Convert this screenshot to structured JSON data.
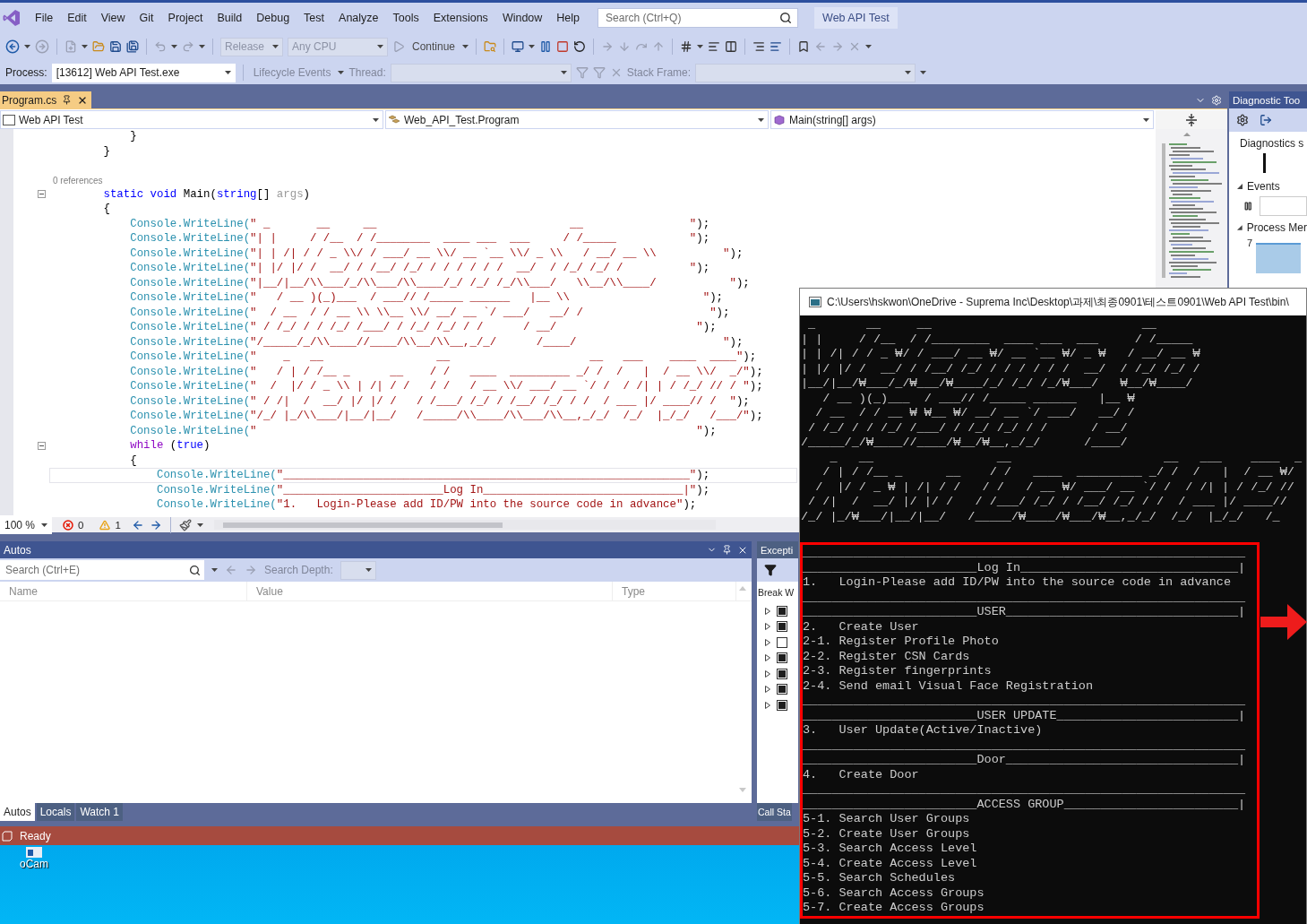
{
  "menu": [
    "File",
    "Edit",
    "View",
    "Git",
    "Project",
    "Build",
    "Debug",
    "Test",
    "Analyze",
    "Tools",
    "Extensions",
    "Window",
    "Help"
  ],
  "search": {
    "placeholder": "Search (Ctrl+Q)"
  },
  "solution_name": "Web API Test",
  "toolbar": {
    "configuration": {
      "value": "Release",
      "disabled": true
    },
    "platform": {
      "value": "Any CPU",
      "disabled": true
    },
    "continue": {
      "label": "Continue"
    }
  },
  "debug_location": {
    "process": {
      "label": "Process:",
      "value": "[13612] Web API Test.exe",
      "disabled": false
    },
    "lifecycle": {
      "label": "Lifecycle Events",
      "disabled": true
    },
    "thread": {
      "label": "Thread:",
      "disabled": true
    },
    "stack_frame": {
      "label": "Stack Frame:",
      "disabled": true
    }
  },
  "document_tabs": [
    {
      "label": "Program.cs",
      "selected": true
    }
  ],
  "navigation": [
    "Web API Test",
    "Web_API_Test.Program",
    "Main(string[] args)"
  ],
  "code_lines": [
    {
      "kind": "code",
      "tokens": [
        {
          "kind": "pl",
          "text": "            }"
        }
      ]
    },
    {
      "kind": "code",
      "tokens": [
        {
          "kind": "pl",
          "text": "        }"
        }
      ]
    },
    {
      "kind": "blank"
    },
    {
      "kind": "lens",
      "text": "0 references"
    },
    {
      "kind": "code",
      "fold": true,
      "tokens": [
        {
          "kind": "kw",
          "text": "        static void"
        },
        {
          "kind": "pl",
          "text": " Main("
        },
        {
          "kind": "kw",
          "text": "string"
        },
        {
          "kind": "pl",
          "text": "[] "
        },
        {
          "kind": "dim",
          "text": "args"
        },
        {
          "kind": "pl",
          "text": ")"
        }
      ]
    },
    {
      "kind": "code",
      "tokens": [
        {
          "kind": "pl",
          "text": "        {"
        }
      ]
    },
    {
      "kind": "code",
      "tokens": [
        {
          "kind": "call",
          "text": "            Console.WriteLine("
        },
        {
          "kind": "str",
          "text": "\" _       __     __                             __                \""
        },
        {
          "kind": "pl",
          "text": ");"
        }
      ]
    },
    {
      "kind": "code",
      "tokens": [
        {
          "kind": "call",
          "text": "            Console.WriteLine("
        },
        {
          "kind": "str",
          "text": "\"| |     / /__  / /________  ____ ___  ___     / /_____           \""
        },
        {
          "kind": "pl",
          "text": ");"
        }
      ]
    },
    {
      "kind": "code",
      "tokens": [
        {
          "kind": "call",
          "text": "            Console.WriteLine("
        },
        {
          "kind": "str",
          "text": "\"| | /| / / _ \\\\/ / ___/ __ \\\\/ __ `__ \\\\/ _ \\\\   / __/ __ \\\\          \""
        },
        {
          "kind": "pl",
          "text": ");"
        }
      ]
    },
    {
      "kind": "code",
      "tokens": [
        {
          "kind": "call",
          "text": "            Console.WriteLine("
        },
        {
          "kind": "str",
          "text": "\"| |/ |/ /  __/ / /__/ /_/ / / / / / /  __/  / /_/ /_/ /          \""
        },
        {
          "kind": "pl",
          "text": ");"
        }
      ]
    },
    {
      "kind": "code",
      "tokens": [
        {
          "kind": "call",
          "text": "            Console.WriteLine("
        },
        {
          "kind": "str",
          "text": "\"|__/|__/\\\\___/_/\\\\___/\\\\____/_/ /_/ /_/\\\\___/   \\\\__/\\\\____/           \""
        },
        {
          "kind": "pl",
          "text": ");"
        }
      ]
    },
    {
      "kind": "code",
      "tokens": [
        {
          "kind": "call",
          "text": "            Console.WriteLine("
        },
        {
          "kind": "str",
          "text": "\"   / __ )(_)___  / ___// /_____ ______   |__ \\\\                    \""
        },
        {
          "kind": "pl",
          "text": ");"
        }
      ]
    },
    {
      "kind": "code",
      "tokens": [
        {
          "kind": "call",
          "text": "            Console.WriteLine("
        },
        {
          "kind": "str",
          "text": "\"  / __  / / __ \\\\ \\\\__ \\\\/ __/ __ `/ ___/   __/ /                   \""
        },
        {
          "kind": "pl",
          "text": ");"
        }
      ]
    },
    {
      "kind": "code",
      "tokens": [
        {
          "kind": "call",
          "text": "            Console.WriteLine("
        },
        {
          "kind": "str",
          "text": "\" / /_/ / / /_/ /___/ / /_/ /_/ / /      / __/                     \""
        },
        {
          "kind": "pl",
          "text": ");"
        }
      ]
    },
    {
      "kind": "code",
      "tokens": [
        {
          "kind": "call",
          "text": "            Console.WriteLine("
        },
        {
          "kind": "str",
          "text": "\"/_____/_/\\\\____//____/\\\\__/\\\\__,_/_/      /____/                      \""
        },
        {
          "kind": "pl",
          "text": ");"
        }
      ]
    },
    {
      "kind": "code",
      "tokens": [
        {
          "kind": "call",
          "text": "            Console.WriteLine("
        },
        {
          "kind": "str",
          "text": "\"    _   __                 __                     __   ___    ____  ____\""
        },
        {
          "kind": "pl",
          "text": ");"
        }
      ]
    },
    {
      "kind": "code",
      "tokens": [
        {
          "kind": "call",
          "text": "            Console.WriteLine("
        },
        {
          "kind": "str",
          "text": "\"   / | / /__ _      __    / /   ____  _________ _/ /  /   |  / __ \\\\/  _/\""
        },
        {
          "kind": "pl",
          "text": ");"
        }
      ]
    },
    {
      "kind": "code",
      "tokens": [
        {
          "kind": "call",
          "text": "            Console.WriteLine("
        },
        {
          "kind": "str",
          "text": "\"  /  |/ / _ \\\\ | /| / /   / /   / __ \\\\/ ___/ __ `/ /  / /| | / /_/ // / \""
        },
        {
          "kind": "pl",
          "text": ");"
        }
      ]
    },
    {
      "kind": "code",
      "tokens": [
        {
          "kind": "call",
          "text": "            Console.WriteLine("
        },
        {
          "kind": "str",
          "text": "\" / /|  /  __/ |/ |/ /   / /___/ /_/ / /__/ /_/ / /  / ___ |/ ____// /  \""
        },
        {
          "kind": "pl",
          "text": ");"
        }
      ]
    },
    {
      "kind": "code",
      "tokens": [
        {
          "kind": "call",
          "text": "            Console.WriteLine("
        },
        {
          "kind": "str",
          "text": "\"/_/ |_/\\\\___/|__/|__/   /_____/\\\\____/\\\\___/\\\\__,_/_/  /_/  |_/_/   /___/\""
        },
        {
          "kind": "pl",
          "text": ");"
        }
      ]
    },
    {
      "kind": "code",
      "tokens": [
        {
          "kind": "call",
          "text": "            Console.WriteLine("
        },
        {
          "kind": "str",
          "text": "\"                                                                  \""
        },
        {
          "kind": "pl",
          "text": ");"
        }
      ]
    },
    {
      "kind": "code",
      "fold": true,
      "tokens": [
        {
          "kind": "ctl",
          "text": "            while"
        },
        {
          "kind": "pl",
          "text": " ("
        },
        {
          "kind": "kw",
          "text": "true"
        },
        {
          "kind": "pl",
          "text": ")"
        }
      ]
    },
    {
      "kind": "code",
      "tokens": [
        {
          "kind": "pl",
          "text": "            {"
        }
      ]
    },
    {
      "kind": "code",
      "current": true,
      "tokens": [
        {
          "kind": "call",
          "text": "                Console.WriteLine("
        },
        {
          "kind": "str",
          "text": "\"_____________________________________________________________\""
        },
        {
          "kind": "pl",
          "text": ");"
        }
      ]
    },
    {
      "kind": "code",
      "tokens": [
        {
          "kind": "call",
          "text": "                Console.WriteLine("
        },
        {
          "kind": "str",
          "text": "\"________________________Log In______________________________|\""
        },
        {
          "kind": "pl",
          "text": ");"
        }
      ]
    },
    {
      "kind": "code",
      "tokens": [
        {
          "kind": "call",
          "text": "                Console.WriteLine("
        },
        {
          "kind": "str",
          "text": "\"1.   Login-Please add ID/PW into the source code in advance\""
        },
        {
          "kind": "pl",
          "text": ");"
        }
      ]
    }
  ],
  "editor_status": {
    "zoom": "100 %",
    "errors": "0",
    "warnings": "1"
  },
  "diagnostic_tools": {
    "title": "Diagnostic Too",
    "summary": "Diagnostics s",
    "sections": [
      {
        "label": "Events",
        "expanded": true
      },
      {
        "label": "Process Mer",
        "expanded": true
      }
    ],
    "reading": "7"
  },
  "autos": {
    "title": "Autos",
    "search_placeholder": "Search (Ctrl+E)",
    "depth_label": "Search Depth:",
    "columns": [
      "Name",
      "Value",
      "Type"
    ],
    "tabs": [
      {
        "label": "Autos",
        "selected": true
      },
      {
        "label": "Locals",
        "selected": false
      },
      {
        "label": "Watch 1",
        "selected": false
      }
    ]
  },
  "exception_settings": {
    "title": "Excepti",
    "column": "Break W",
    "rows": [
      {
        "checked": true
      },
      {
        "checked": true
      },
      {
        "checked": false
      },
      {
        "checked": true
      },
      {
        "checked": true
      },
      {
        "checked": true
      },
      {
        "checked": true
      }
    ],
    "tab": "Call Sta"
  },
  "status_bar": {
    "text": "Ready"
  },
  "desktop_icons": [
    "oCam"
  ],
  "console": {
    "title": "C:\\Users\\hskwon\\OneDrive - Suprema Inc\\Desktop\\과제\\최종0901\\테스트0901\\Web API Test\\bin\\",
    "banner": [
      " _       __     __                             __",
      "| |     / /__  / /________  ____ ___  ___     / /_____",
      "| | /| / / _ ₩/ / ___/ __ ₩/ __ `__ ₩/ _ ₩   / __/ __ ₩",
      "| |/ |/ /  __/ / /__/ /_/ / / / / / /  __/  / /_/ /_/ /",
      "|__/|__/₩___/_/₩___/₩____/_/ /_/ /_/₩___/   ₩__/₩____/",
      "   / __ )(_)___  / ___// /_____ ______   |__ ₩",
      "  / __  / / __ ₩ ₩__ ₩/ __/ __ `/ ___/   __/ /",
      " / /_/ / / /_/ /___/ / /_/ /_/ / /      / __/",
      "/_____/_/₩____//____/₩__/₩__,_/_/      /____/",
      "    _   __                 __                     __   ___    ____  _",
      "   / | / /__ _      __    / /   ____  _________ _/ /  /   |  / __ ₩/",
      "  /  |/ / _ ₩ | /| / /   / /   / __ ₩/ ___/ __ `/ /  / /| | / /_/ //",
      " / /|  /  __/ |/ |/ /   / /___/ /_/ / /__/ /_/ / /  / ___ |/ ____//",
      "/_/ |_/₩___/|__/|__/   /_____/₩____/₩___/₩__,_/_/  /_/  |_/_/   /_"
    ],
    "sections": [
      {
        "rule": "_____________________________________________________________",
        "heading": "________________________Log In______________________________|",
        "items": [
          "1.   Login-Please add ID/PW into the source code in advance"
        ]
      },
      {
        "rule": "_____________________________________________________________",
        "heading": "________________________USER________________________________|",
        "items": [
          "2.   Create User",
          "2-1. Register Profile Photo",
          "2-2. Register CSN Cards",
          "2-3. Register fingerprints",
          "2-4. Send email Visual Face Registration"
        ]
      },
      {
        "rule": "_____________________________________________________________",
        "heading": "________________________USER UPDATE_________________________|",
        "items": [
          "3.   User Update(Active/Inactive)"
        ]
      },
      {
        "rule": "_____________________________________________________________",
        "heading": "________________________Door________________________________|",
        "items": [
          "4.   Create Door"
        ]
      },
      {
        "rule": "_____________________________________________________________",
        "heading": "________________________ACCESS GROUP________________________|",
        "items": [
          "5-1. Search User Groups",
          "5-2. Create User Groups",
          "5-3. Search Access Level",
          "5-4. Create Access Level",
          "5-5. Search Schedules",
          "5-6. Search Access Groups",
          "5-7. Create Access Groups"
        ]
      }
    ]
  }
}
